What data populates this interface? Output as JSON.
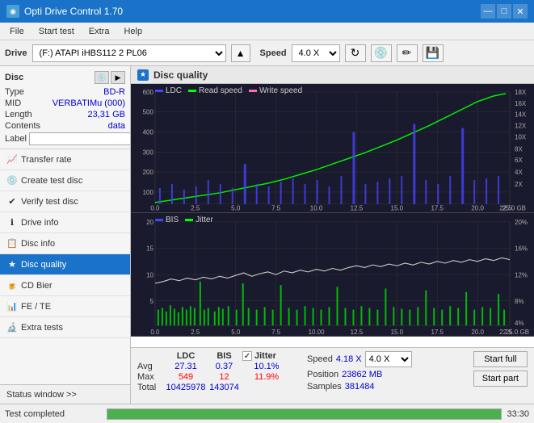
{
  "app": {
    "title": "Opti Drive Control 1.70",
    "title_icon": "◉"
  },
  "title_controls": {
    "minimize": "—",
    "maximize": "□",
    "close": "✕"
  },
  "menu": {
    "items": [
      "File",
      "Start test",
      "Extra",
      "Help"
    ]
  },
  "drive_bar": {
    "label": "Drive",
    "drive_value": "(F:)  ATAPI iHBS112  2 PL06",
    "speed_label": "Speed",
    "speed_value": "4.0 X"
  },
  "disc": {
    "title": "Disc",
    "type_label": "Type",
    "type_value": "BD-R",
    "mid_label": "MID",
    "mid_value": "VERBATIMu (000)",
    "length_label": "Length",
    "length_value": "23,31 GB",
    "contents_label": "Contents",
    "contents_value": "data",
    "label_label": "Label",
    "label_value": ""
  },
  "sidebar_nav": [
    {
      "id": "transfer-rate",
      "label": "Transfer rate",
      "icon": "📈"
    },
    {
      "id": "create-test-disc",
      "label": "Create test disc",
      "icon": "💿"
    },
    {
      "id": "verify-test-disc",
      "label": "Verify test disc",
      "icon": "✔"
    },
    {
      "id": "drive-info",
      "label": "Drive info",
      "icon": "ℹ"
    },
    {
      "id": "disc-info",
      "label": "Disc info",
      "icon": "📋"
    },
    {
      "id": "disc-quality",
      "label": "Disc quality",
      "icon": "★",
      "active": true
    },
    {
      "id": "cd-bier",
      "label": "CD Bier",
      "icon": "🍺"
    },
    {
      "id": "fe-te",
      "label": "FE / TE",
      "icon": "📊"
    },
    {
      "id": "extra-tests",
      "label": "Extra tests",
      "icon": "🔬"
    }
  ],
  "status_window": "Status window >>",
  "content": {
    "title": "Disc quality",
    "icon": "★"
  },
  "chart_top": {
    "legend": [
      {
        "color": "#0000ff",
        "label": "LDC"
      },
      {
        "color": "#00ff00",
        "label": "Read speed"
      },
      {
        "color": "#ff69b4",
        "label": "Write speed"
      }
    ],
    "y_labels": [
      "600",
      "500",
      "400",
      "300",
      "200",
      "100",
      "0"
    ],
    "y_labels_right": [
      "18X",
      "16X",
      "14X",
      "12X",
      "10X",
      "8X",
      "6X",
      "4X",
      "2X"
    ],
    "x_labels": [
      "0.0",
      "2.5",
      "5.0",
      "7.5",
      "10.00",
      "12.5",
      "15.0",
      "17.5",
      "20.0",
      "22.5",
      "25.0 GB"
    ]
  },
  "chart_bottom": {
    "legend": [
      {
        "color": "#0000ff",
        "label": "BIS"
      },
      {
        "color": "#00ff00",
        "label": "Jitter"
      }
    ],
    "y_labels": [
      "20",
      "15",
      "10",
      "5"
    ],
    "y_labels_right": [
      "20%",
      "16%",
      "12%",
      "8%",
      "4%"
    ],
    "x_labels": [
      "0.0",
      "2.5",
      "5.0",
      "7.5",
      "10.00",
      "12.5",
      "15.0",
      "17.5",
      "20.0",
      "22.5",
      "25.0 GB"
    ]
  },
  "stats": {
    "ldc_header": "LDC",
    "bis_header": "BIS",
    "jitter_header": "Jitter",
    "speed_header": "Speed",
    "jitter_checkbox": true,
    "avg_label": "Avg",
    "max_label": "Max",
    "total_label": "Total",
    "ldc_avg": "27.31",
    "ldc_max": "549",
    "ldc_total": "10425978",
    "bis_avg": "0.37",
    "bis_max": "12",
    "bis_total": "143074",
    "jitter_avg": "10.1%",
    "jitter_max": "11.9%",
    "jitter_total": "",
    "speed_value": "4.18 X",
    "speed_select": "4.0 X",
    "position_label": "Position",
    "position_value": "23862 MB",
    "samples_label": "Samples",
    "samples_value": "381484",
    "start_full_label": "Start full",
    "start_part_label": "Start part"
  },
  "bottom": {
    "status_text": "Test completed",
    "progress": 100,
    "time": "33:30"
  }
}
